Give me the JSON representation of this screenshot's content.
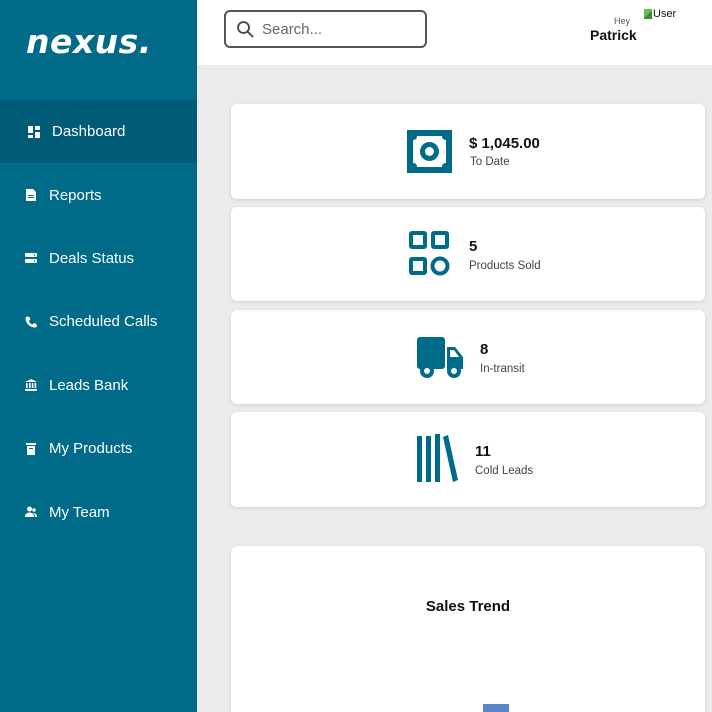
{
  "app": {
    "logo": "nexus."
  },
  "sidebar": {
    "items": [
      {
        "label": "Dashboard",
        "icon": "dashboard-icon",
        "active": true
      },
      {
        "label": "Reports",
        "icon": "document-icon"
      },
      {
        "label": "Deals Status",
        "icon": "server-icon"
      },
      {
        "label": "Scheduled Calls",
        "icon": "phone-icon"
      },
      {
        "label": "Leads Bank",
        "icon": "bank-icon"
      },
      {
        "label": "My Products",
        "icon": "box-icon"
      },
      {
        "label": "My Team",
        "icon": "team-icon"
      }
    ]
  },
  "header": {
    "search": {
      "placeholder": "Search...",
      "value": ""
    },
    "greeting": "Hey",
    "user_name": "Patrick",
    "avatar_alt": "User"
  },
  "stats": [
    {
      "value": "$ 1,045.00",
      "label": "To Date",
      "icon": "money-icon"
    },
    {
      "value": "5",
      "label": "Products Sold",
      "icon": "grid-apps-icon"
    },
    {
      "value": "8",
      "label": "In-transit",
      "icon": "truck-icon"
    },
    {
      "value": "11",
      "label": "Cold Leads",
      "icon": "books-icon"
    }
  ],
  "chart": {
    "title": "Sales Trend"
  },
  "colors": {
    "brand": "#006a89",
    "brand_active": "#005b76",
    "background": "#ebebeb",
    "bar": "#5b86c7"
  }
}
